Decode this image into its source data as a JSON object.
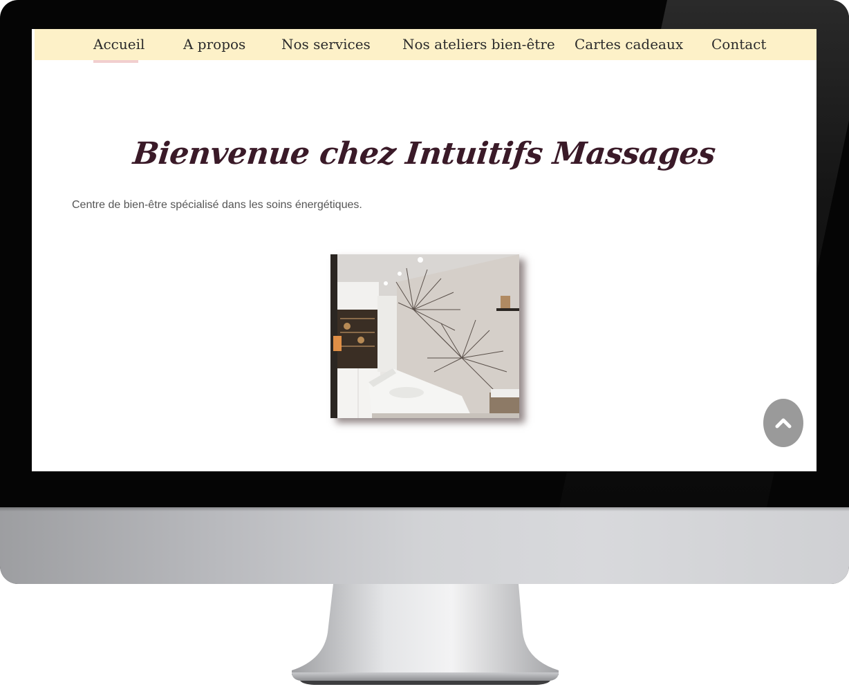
{
  "nav": {
    "items": [
      {
        "label": "Accueil",
        "active": true
      },
      {
        "label": "A propos",
        "active": false
      },
      {
        "label": "Nos services",
        "active": false
      },
      {
        "label": "Nos ateliers bien-être",
        "active": false
      },
      {
        "label": "Cartes cadeaux",
        "active": false
      },
      {
        "label": "Contact",
        "active": false
      }
    ]
  },
  "main": {
    "title": "Bienvenue chez Intuitifs Massages",
    "intro": "Centre de bien-être spécialisé dans les soins énergétiques."
  },
  "scroll_top": {
    "icon": "chevron-up-icon"
  },
  "colors": {
    "nav_background": "#fdf1c8",
    "active_underline": "#f1cfcf",
    "title": "#3a1a28",
    "scroll_button": "#9a9a9a"
  }
}
